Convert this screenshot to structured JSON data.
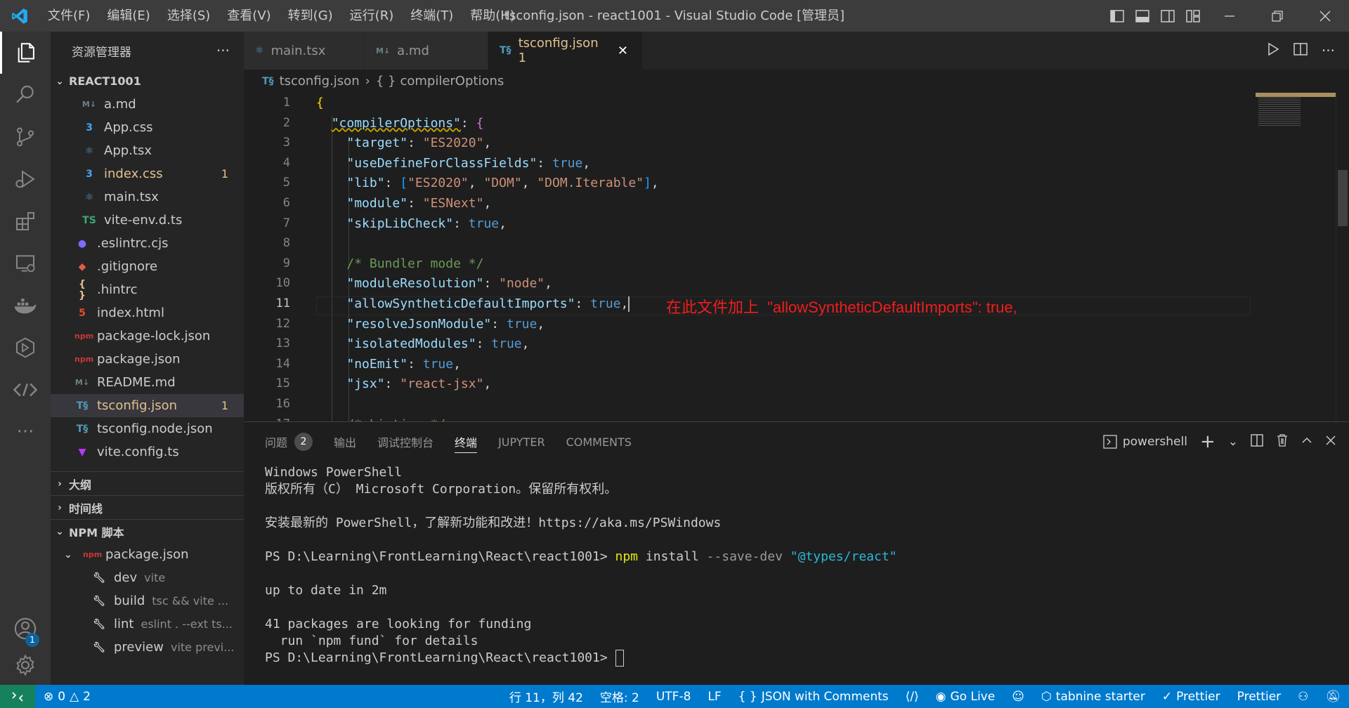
{
  "window": {
    "title": "tsconfig.json - react1001 - Visual Studio Code [管理员]"
  },
  "menu": [
    "文件(F)",
    "编辑(E)",
    "选择(S)",
    "查看(V)",
    "转到(G)",
    "运行(R)",
    "终端(T)",
    "帮助(H)"
  ],
  "activity": {
    "accounts_badge": "1"
  },
  "sidebar": {
    "title": "资源管理器",
    "more": "···",
    "project": "REACT1001",
    "files": [
      {
        "name": "a.md",
        "icon": "M↓",
        "color": "#6d8086",
        "indent": 2
      },
      {
        "name": "App.css",
        "icon": "3",
        "color": "#42a5f5",
        "indent": 2
      },
      {
        "name": "App.tsx",
        "icon": "⚛",
        "color": "#519aba",
        "indent": 2
      },
      {
        "name": "index.css",
        "icon": "3",
        "color": "#42a5f5",
        "indent": 2,
        "modified": true,
        "count": "1"
      },
      {
        "name": "main.tsx",
        "icon": "⚛",
        "color": "#519aba",
        "indent": 2
      },
      {
        "name": "vite-env.d.ts",
        "icon": "TS",
        "color": "#3aa876",
        "indent": 2
      },
      {
        "name": ".eslintrc.cjs",
        "icon": "●",
        "color": "#7c6cff",
        "indent": 1
      },
      {
        "name": ".gitignore",
        "icon": "◆",
        "color": "#e05d44",
        "indent": 1
      },
      {
        "name": ".hintrc",
        "icon": "{ }",
        "color": "#e2c08d",
        "indent": 1
      },
      {
        "name": "index.html",
        "icon": "5",
        "color": "#e44d26",
        "indent": 1
      },
      {
        "name": "package-lock.json",
        "icon": "npm",
        "color": "#cb3837",
        "indent": 1
      },
      {
        "name": "package.json",
        "icon": "npm",
        "color": "#cb3837",
        "indent": 1
      },
      {
        "name": "README.md",
        "icon": "M↓",
        "color": "#6d8086",
        "indent": 1
      },
      {
        "name": "tsconfig.json",
        "icon": "T§",
        "color": "#519aba",
        "indent": 1,
        "modified": true,
        "selected": true,
        "count": "1"
      },
      {
        "name": "tsconfig.node.json",
        "icon": "T§",
        "color": "#519aba",
        "indent": 1
      },
      {
        "name": "vite.config.ts",
        "icon": "▼",
        "color": "#bd34fe",
        "indent": 1
      }
    ],
    "outline": "大纲",
    "timeline": "时间线",
    "npm": "NPM 脚本",
    "npm_package": "package.json",
    "scripts": [
      {
        "name": "dev",
        "cmd": "vite"
      },
      {
        "name": "build",
        "cmd": "tsc && vite ..."
      },
      {
        "name": "lint",
        "cmd": "eslint . --ext ts..."
      },
      {
        "name": "preview",
        "cmd": "vite previ..."
      }
    ]
  },
  "tabs": [
    {
      "label": "main.tsx",
      "icon": "⚛",
      "color": "#519aba"
    },
    {
      "label": "a.md",
      "icon": "M↓",
      "color": "#6d8086"
    },
    {
      "label": "tsconfig.json 1",
      "icon": "T§",
      "color": "#519aba",
      "active": true
    }
  ],
  "breadcrumb": {
    "file": "tsconfig.json",
    "symbol": "compilerOptions"
  },
  "editor": {
    "current_line": 11,
    "lines": [
      [
        [
          "br",
          "{"
        ]
      ],
      [
        [
          "p",
          "  "
        ],
        [
          "k",
          "\"compilerOptions\""
        ],
        [
          "p",
          ": "
        ],
        [
          "br2",
          "{"
        ]
      ],
      [
        [
          "p",
          "    "
        ],
        [
          "k",
          "\"target\""
        ],
        [
          "p",
          ": "
        ],
        [
          "s",
          "\"ES2020\""
        ],
        [
          "p",
          ","
        ]
      ],
      [
        [
          "p",
          "    "
        ],
        [
          "k",
          "\"useDefineForClassFields\""
        ],
        [
          "p",
          ": "
        ],
        [
          "b",
          "true"
        ],
        [
          "p",
          ","
        ]
      ],
      [
        [
          "p",
          "    "
        ],
        [
          "k",
          "\"lib\""
        ],
        [
          "p",
          ": "
        ],
        [
          "br3",
          "["
        ],
        [
          "s",
          "\"ES2020\""
        ],
        [
          "p",
          ", "
        ],
        [
          "s",
          "\"DOM\""
        ],
        [
          "p",
          ", "
        ],
        [
          "s",
          "\"DOM.Iterable\""
        ],
        [
          "br3",
          "]"
        ],
        [
          "p",
          ","
        ]
      ],
      [
        [
          "p",
          "    "
        ],
        [
          "k",
          "\"module\""
        ],
        [
          "p",
          ": "
        ],
        [
          "s",
          "\"ESNext\""
        ],
        [
          "p",
          ","
        ]
      ],
      [
        [
          "p",
          "    "
        ],
        [
          "k",
          "\"skipLibCheck\""
        ],
        [
          "p",
          ": "
        ],
        [
          "b",
          "true"
        ],
        [
          "p",
          ","
        ]
      ],
      [],
      [
        [
          "p",
          "    "
        ],
        [
          "c",
          "/* Bundler mode */"
        ]
      ],
      [
        [
          "p",
          "    "
        ],
        [
          "k",
          "\"moduleResolution\""
        ],
        [
          "p",
          ": "
        ],
        [
          "s",
          "\"node\""
        ],
        [
          "p",
          ","
        ]
      ],
      [
        [
          "p",
          "    "
        ],
        [
          "k",
          "\"allowSyntheticDefaultImports\""
        ],
        [
          "p",
          ": "
        ],
        [
          "b",
          "true"
        ],
        [
          "p",
          ","
        ]
      ],
      [
        [
          "p",
          "    "
        ],
        [
          "k",
          "\"resolveJsonModule\""
        ],
        [
          "p",
          ": "
        ],
        [
          "b",
          "true"
        ],
        [
          "p",
          ","
        ]
      ],
      [
        [
          "p",
          "    "
        ],
        [
          "k",
          "\"isolatedModules\""
        ],
        [
          "p",
          ": "
        ],
        [
          "b",
          "true"
        ],
        [
          "p",
          ","
        ]
      ],
      [
        [
          "p",
          "    "
        ],
        [
          "k",
          "\"noEmit\""
        ],
        [
          "p",
          ": "
        ],
        [
          "b",
          "true"
        ],
        [
          "p",
          ","
        ]
      ],
      [
        [
          "p",
          "    "
        ],
        [
          "k",
          "\"jsx\""
        ],
        [
          "p",
          ": "
        ],
        [
          "s",
          "\"react-jsx\""
        ],
        [
          "p",
          ","
        ]
      ],
      [],
      [
        [
          "p",
          "    "
        ],
        [
          "c",
          "/* Linting */"
        ]
      ]
    ],
    "annotation": "在此文件加上  \"allowSyntheticDefaultImports\": true,"
  },
  "panel": {
    "tabs": [
      {
        "label": "问题",
        "badge": "2"
      },
      {
        "label": "输出"
      },
      {
        "label": "调试控制台"
      },
      {
        "label": "终端",
        "active": true
      },
      {
        "label": "JUPYTER"
      },
      {
        "label": "COMMENTS"
      }
    ],
    "shell": "powershell",
    "terminal": [
      [
        [
          "t",
          "Windows PowerShell"
        ]
      ],
      [
        [
          "t",
          "版权所有（C） Microsoft Corporation。保留所有权利。"
        ]
      ],
      [],
      [
        [
          "t",
          "安装最新的 PowerShell，了解新功能和改进！https://aka.ms/PSWindows"
        ]
      ],
      [],
      [
        [
          "t",
          "PS D:\\Learning\\FrontLearning\\React\\react1001> "
        ],
        [
          "y",
          "npm"
        ],
        [
          "t",
          " install "
        ],
        [
          "g",
          "--save-dev"
        ],
        [
          "t",
          " "
        ],
        [
          "c",
          "\"@types/react\""
        ]
      ],
      [],
      [
        [
          "t",
          "up to date in 2m"
        ]
      ],
      [],
      [
        [
          "t",
          "41 packages are looking for funding"
        ]
      ],
      [
        [
          "t",
          "  run `npm fund` for details"
        ]
      ],
      [
        [
          "t",
          "PS D:\\Learning\\FrontLearning\\React\\react1001> "
        ],
        [
          "cursor",
          ""
        ]
      ]
    ]
  },
  "status": {
    "errors": "0",
    "warnings": "2",
    "position": "行 11，列 42",
    "spaces": "空格: 2",
    "encoding": "UTF-8",
    "eol": "LF",
    "language": "JSON with Comments",
    "golive": "Go Live",
    "tabnine": "tabnine starter",
    "prettier1": "Prettier",
    "prettier2": "Prettier"
  }
}
